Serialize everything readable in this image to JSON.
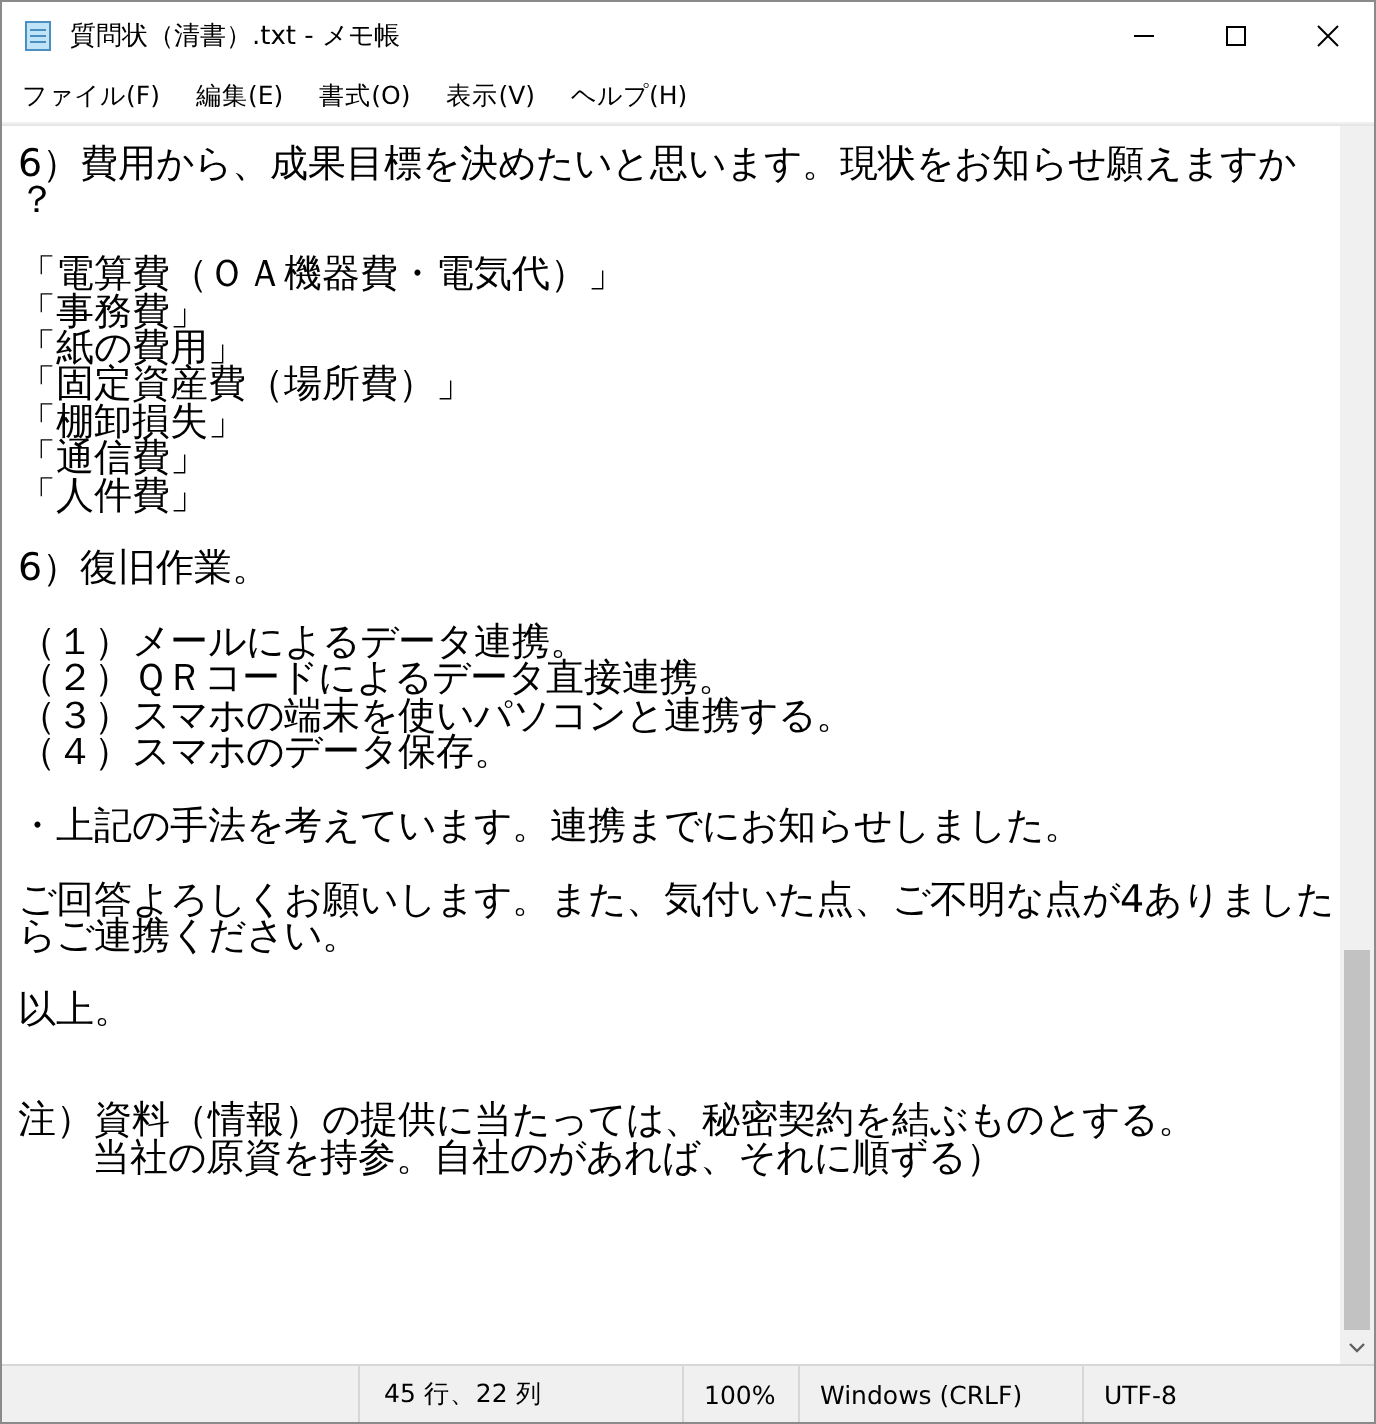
{
  "window": {
    "title": "質問状（清書）.txt - メモ帳"
  },
  "menu": [
    "ファイル(F)",
    "編集(E)",
    "書式(O)",
    "表示(V)",
    "ヘルプ(H)"
  ],
  "editor": {
    "lines": [
      {
        "kind": "text",
        "text": "6）費用から、成果目標を決めたいと思います。現状をお知らせ願えますか"
      },
      {
        "kind": "text",
        "text": "？"
      },
      {
        "kind": "blank"
      },
      {
        "kind": "text",
        "text": "「電算費（ＯＡ機器費・電気代）」"
      },
      {
        "kind": "text",
        "text": "「事務費」"
      },
      {
        "kind": "text",
        "text": "「紙の費用」"
      },
      {
        "kind": "text",
        "text": "「固定資産費（場所費）」"
      },
      {
        "kind": "text",
        "text": "「棚卸損失」"
      },
      {
        "kind": "text",
        "text": "「通信費」"
      },
      {
        "kind": "text",
        "text": "「人件費」"
      },
      {
        "kind": "blank"
      },
      {
        "kind": "text",
        "text": "6）復旧作業。"
      },
      {
        "kind": "blank"
      },
      {
        "kind": "text",
        "text": "（１）メールによるデータ連携。"
      },
      {
        "kind": "text",
        "text": "（２）ＱＲコードによるデータ直接連携。"
      },
      {
        "kind": "text",
        "text": "（３）スマホの端末を使いパソコンと連携する。"
      },
      {
        "kind": "text",
        "text": "（４）スマホのデータ保存。"
      },
      {
        "kind": "blank"
      },
      {
        "kind": "text",
        "text": "・上記の手法を考えています。連携までにお知らせしました。"
      },
      {
        "kind": "blank"
      },
      {
        "kind": "text",
        "text": "ご回答よろしくお願いします。また、気付いた点、ご不明な点が4ありました"
      },
      {
        "kind": "text",
        "text": "らご連携ください。"
      },
      {
        "kind": "blank"
      },
      {
        "kind": "text",
        "text": "以上。"
      },
      {
        "kind": "blank"
      },
      {
        "kind": "blank"
      },
      {
        "kind": "text",
        "text": "注）資料（情報）の提供に当たっては、秘密契約を結ぶものとする。"
      },
      {
        "kind": "indented",
        "text": "当社の原資を持参。自社のがあれば、それに順ずる）"
      }
    ]
  },
  "status_bar": {
    "position": "45 行、22 列",
    "zoom": "100%",
    "line_ending": "Windows (CRLF)",
    "encoding": "UTF-8"
  }
}
